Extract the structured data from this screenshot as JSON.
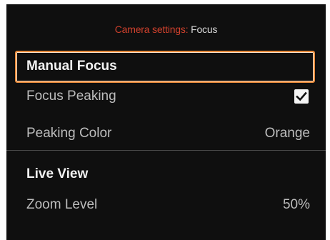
{
  "header": {
    "crumb_label": "Camera settings:",
    "crumb_page": "Focus"
  },
  "sections": [
    {
      "title": "Manual Focus",
      "selected": true,
      "items": [
        {
          "label": "Focus Peaking",
          "value_type": "checkbox",
          "checked": true
        },
        {
          "label": "Peaking Color",
          "value": "Orange"
        }
      ]
    },
    {
      "title": "Live View",
      "items": [
        {
          "label": "Zoom Level",
          "value": "50%"
        }
      ]
    }
  ],
  "colors": {
    "panel_bg": "#0f0f0f",
    "accent_label": "#d0412d",
    "selection_border": "#e88a3a",
    "text_primary": "#f2f2f2",
    "text_secondary": "#bdbdbd"
  }
}
